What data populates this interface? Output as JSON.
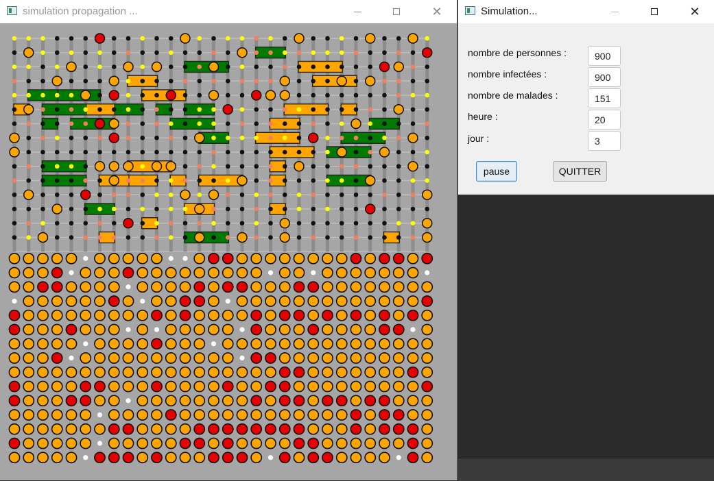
{
  "window_left": {
    "title": "simulation propagation ...",
    "controls": {
      "minimize": "minimize-icon",
      "maximize": "maximize-icon",
      "close": "close-icon"
    }
  },
  "window_right": {
    "title": "Simulation...",
    "labels": {
      "personnes": "nombre de personnes :",
      "infectees": "nombre infectées :",
      "malades": "nombre de malades :",
      "heure": "heure :",
      "jour": "jour :"
    },
    "values": {
      "personnes": "900",
      "infectees": "900",
      "malades": "151",
      "heure": "20",
      "jour": "3"
    },
    "buttons": {
      "pause": "pause",
      "quitter": "QUITTER"
    }
  },
  "colors": {
    "background": "#a6a6a6",
    "healthy_white": "#ffffff",
    "infected_orange": "#ffa500",
    "sick_red": "#e60000",
    "building_green": "#007a00",
    "building_orange": "#ffa500",
    "node_black": "#111111",
    "node_yellow": "#ffff00",
    "node_salmon": "#f08060"
  },
  "simulation": {
    "crowd_rows": [
      "OOOOOWOOOOOWWORROOOOOOOORORROR",
      "OOORWOOOROOOOOOOOOWOOWOOOOOOOW",
      "OORROOOOWOOOORORROOORROOOOOOOO",
      "WOOOOOOROWOORROWOOOOOOOOOOOOOR",
      "ROOOOOOOOOROROOOORORRORORORORO",
      "ROOOROOOWOWOOOOOWROOOROOOORRWO",
      "OOOOOWOOOOROOOWOOOOOOOOOOOOOOO",
      "OOORWOOOOOOOOOOOWRROOOOOOOOOOO",
      "OOOOOOOOOOOOOOOOOOORROOOOOOORO",
      "ROOOORROOOROOOOROORROOOOOOOOOR",
      "ROOORROOWOOOOOOOORORRORRORROOO",
      "OOOOOOWOOOOROOOOOOOOOOOORORROO",
      "OOOOOOORROOOORRRRRRRROOORORRRO",
      "ROOOOOWOOOOORROROOOORROOOOOORO",
      "OOOOOWRRROROOORRROWRORROOOOWRO"
    ]
  }
}
